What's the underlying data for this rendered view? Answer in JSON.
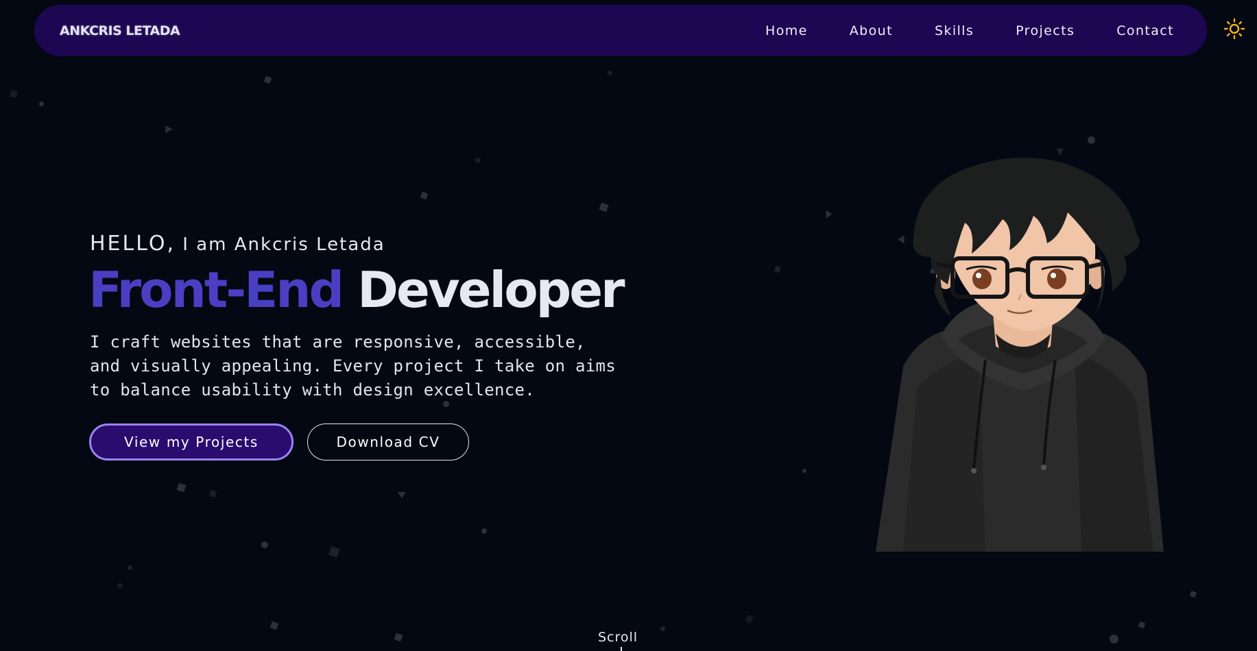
{
  "nav": {
    "brand": "ANKCRIS LETADA",
    "links": [
      "Home",
      "About",
      "Skills",
      "Projects",
      "Contact"
    ],
    "theme_icon": "sun-icon"
  },
  "hero": {
    "greeting_hello": "HELLO,",
    "greeting_rest": "I am Ankcris Letada",
    "title_accent": "Front-End",
    "title_rest": "Developer",
    "description_lines": [
      "I craft websites that are responsive, accessible,",
      "and visually appealing. Every project I take on aims",
      "to balance usability with design excellence."
    ],
    "primary_button": "View my Projects",
    "secondary_button": "Download CV"
  },
  "scroll_label": "Scroll",
  "colors": {
    "background": "#030812",
    "navbar": "#1d0652",
    "accent": "#4a3fc2",
    "primary_button_bg": "#2a0b6e",
    "primary_button_border": "#9b84f4",
    "sun_icon": "#f5b21a"
  }
}
